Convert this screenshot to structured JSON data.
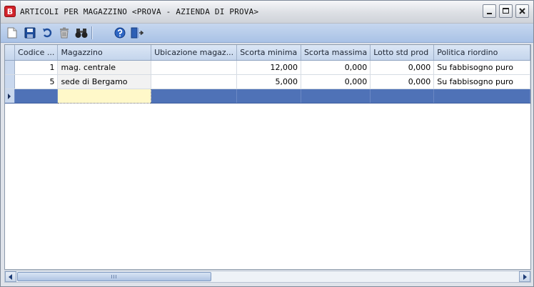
{
  "window": {
    "title": "ARTICOLI PER MAGAZZINO <PROVA - AZIENDA DI PROVA>",
    "app_icon_letter": "B"
  },
  "toolbar": {
    "buttons": [
      "new-document-icon",
      "save-icon",
      "undo-icon",
      "delete-icon",
      "find-icon",
      "help-icon",
      "exit-icon"
    ]
  },
  "grid": {
    "columns": [
      "Codice ...",
      "Magazzino",
      "Ubicazione magaz...",
      "Scorta minima",
      "Scorta massima",
      "Lotto std prod",
      "Politica riordino"
    ],
    "rows": [
      [
        "1",
        "mag. centrale",
        "",
        "12,000",
        "0,000",
        "0,000",
        "Su fabbisogno puro"
      ],
      [
        "5",
        "sede di Bergamo",
        "",
        "5,000",
        "0,000",
        "0,000",
        "Su fabbisogno puro"
      ]
    ]
  },
  "colors": {
    "selection_row": "#4f72b7",
    "header": "#c4d5ec",
    "toolbar": "#a9c2e6"
  }
}
